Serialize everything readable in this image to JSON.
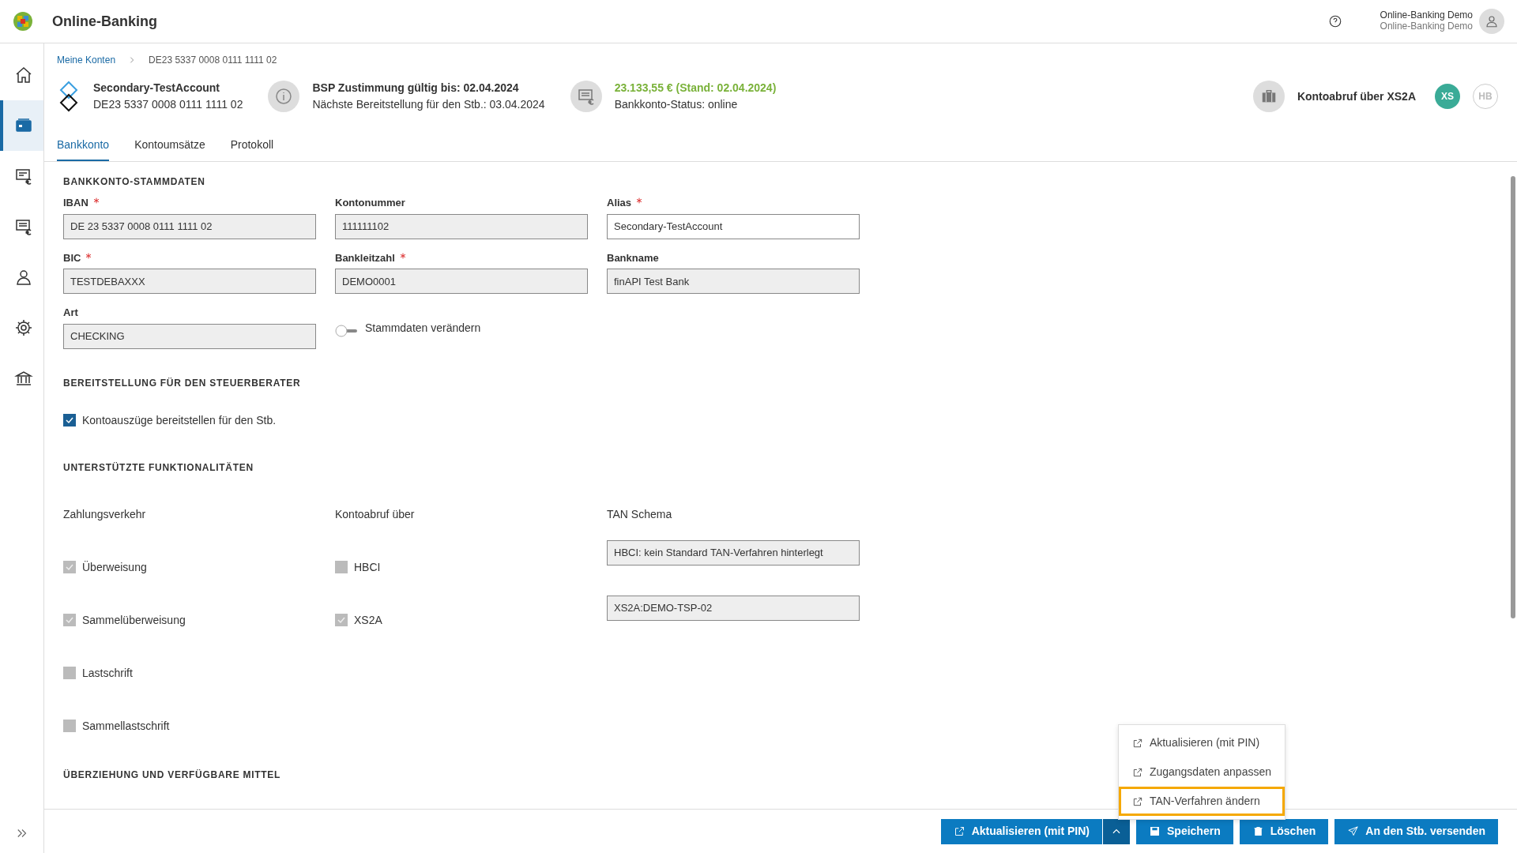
{
  "header": {
    "title": "Online-Banking",
    "user_name": "Online-Banking Demo",
    "user_org": "Online-Banking Demo"
  },
  "sidebar": {
    "items": [
      {
        "kind": "home",
        "selected": false
      },
      {
        "kind": "accounts",
        "selected": true
      },
      {
        "kind": "payments",
        "selected": false
      },
      {
        "kind": "statements",
        "selected": false
      },
      {
        "kind": "person",
        "selected": false
      },
      {
        "kind": "settings",
        "selected": false
      },
      {
        "kind": "bank",
        "selected": false
      }
    ]
  },
  "breadcrumb": [
    {
      "label": "Meine Konten",
      "link": true
    },
    {
      "label": "DE23 5337 0008 0111 1111 02",
      "link": false
    }
  ],
  "account": {
    "name": "Secondary-TestAccount",
    "iban": "DE23 5337 0008 0111 1111 02"
  },
  "consent": {
    "title": "BSP Zustimmung gültig bis: 02.04.2024",
    "next": "Nächste Bereitstellung für den Stb.: 03.04.2024"
  },
  "balance": {
    "amount": "23.133,55 € (Stand: 02.04.2024)",
    "status": "Bankkonto-Status: online"
  },
  "retrieval": {
    "label": "Kontoabruf über XS2A",
    "badges": [
      {
        "label": "XS",
        "selected": true
      },
      {
        "label": "HB",
        "selected": false
      }
    ]
  },
  "tabs": [
    {
      "label": "Bankkonto",
      "selected": true
    },
    {
      "label": "Kontoumsätze",
      "selected": false
    },
    {
      "label": "Protokoll",
      "selected": false
    }
  ],
  "master_data": {
    "title": "BANKKONTO-STAMMDATEN",
    "fields": [
      {
        "label": "IBAN",
        "required": true,
        "value": "DE 23 5337 0008 0111 1111 02",
        "disabled": true
      },
      {
        "label": "Kontonummer",
        "required": false,
        "value": "111111102",
        "disabled": true
      },
      {
        "label": "Alias",
        "required": true,
        "value": "Secondary-TestAccount",
        "disabled": false
      },
      {
        "label": "BIC",
        "required": true,
        "value": "TESTDEBAXXX",
        "disabled": true
      },
      {
        "label": "Bankleitzahl",
        "required": true,
        "value": "DEMO0001",
        "disabled": true
      },
      {
        "label": "Bankname",
        "required": false,
        "value": "finAPI Test Bank",
        "disabled": true
      },
      {
        "label": "Art",
        "required": false,
        "value": "CHECKING",
        "disabled": true
      }
    ],
    "toggle": {
      "label": "Stammdaten verändern",
      "on": false
    }
  },
  "provision": {
    "title": "BEREITSTELLUNG FÜR DEN STEUERBERATER",
    "checkbox": {
      "label": "Kontoauszüge bereitstellen für den Stb.",
      "checked": true,
      "disabled": false
    }
  },
  "functions": {
    "title": "UNTERSTÜTZTE FUNKTIONALITÄTEN",
    "payments": {
      "heading": "Zahlungsverkehr",
      "items": [
        {
          "label": "Überweisung",
          "checked": true,
          "disabled": true
        },
        {
          "label": "Sammelüberweisung",
          "checked": true,
          "disabled": true
        },
        {
          "label": "Lastschrift",
          "checked": false,
          "disabled": true
        },
        {
          "label": "Sammellastschrift",
          "checked": false,
          "disabled": true
        }
      ]
    },
    "retrieval": {
      "heading": "Kontoabruf über",
      "items": [
        {
          "label": "HBCI",
          "checked": false,
          "disabled": true
        },
        {
          "label": "XS2A",
          "checked": true,
          "disabled": true
        }
      ]
    },
    "tan": {
      "heading": "TAN Schema",
      "values": [
        "HBCI: kein Standard TAN-Verfahren hinterlegt",
        "XS2A:DEMO-TSP-02"
      ]
    }
  },
  "overdraft": {
    "title": "ÜBERZIEHUNG UND VERFÜGBARE MITTEL"
  },
  "menu": [
    {
      "label": "Aktualisieren (mit PIN)",
      "selected": false
    },
    {
      "label": "Zugangsdaten anpassen",
      "selected": false
    },
    {
      "label": "TAN-Verfahren ändern",
      "selected": true
    }
  ],
  "buttons": [
    {
      "kind": "external",
      "label": "Aktualisieren (mit PIN)"
    },
    {
      "kind": "toggle"
    },
    {
      "kind": "save",
      "label": "Speichern"
    },
    {
      "kind": "delete",
      "label": "Löschen"
    },
    {
      "kind": "send",
      "label": "An den Stb. versenden"
    }
  ]
}
